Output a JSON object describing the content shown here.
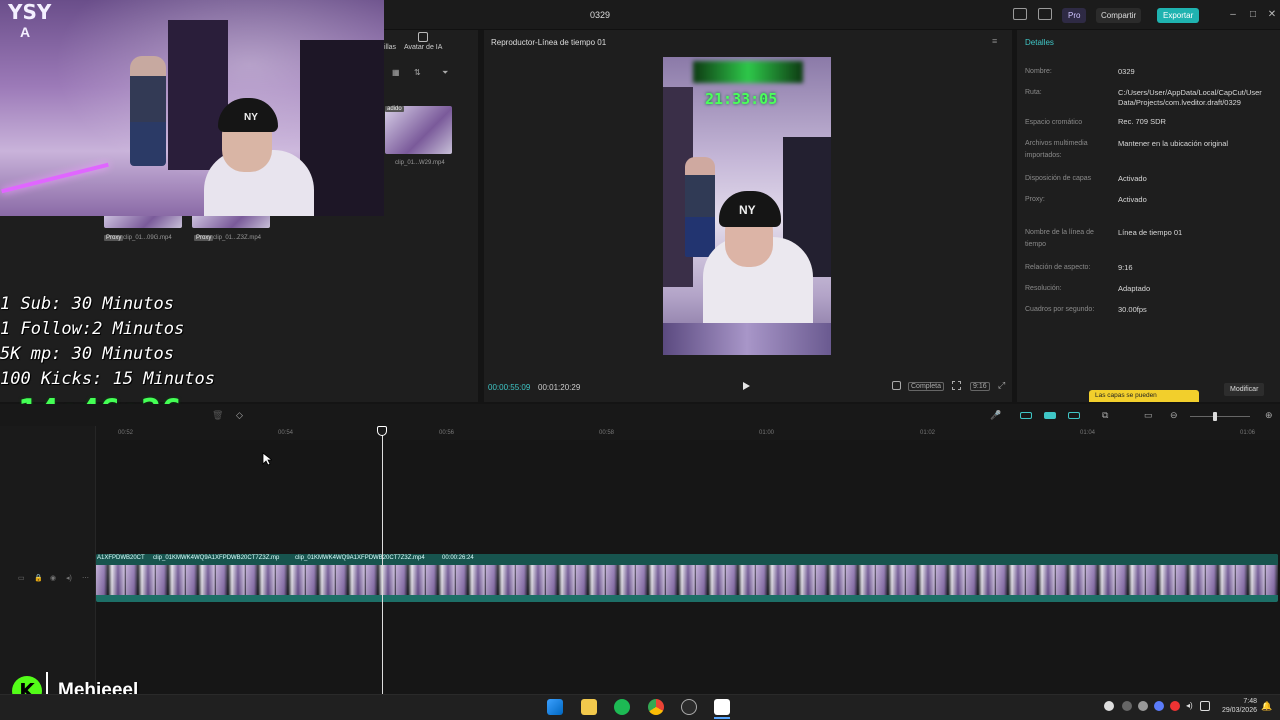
{
  "window": {
    "project_title": "0329",
    "pro_label": "Pro",
    "share_label": "Compartir",
    "export_label": "Exportar",
    "accent_color": "#1fb3b0"
  },
  "webcam": {
    "logo_line1": "YSY",
    "logo_line2": "A",
    "cap_logo": "NY"
  },
  "media_panel": {
    "tabs": [
      "illas",
      "Avatar de IA"
    ],
    "clip_tag": "adido",
    "clips": [
      {
        "proxy": "Proxy",
        "name": "clip_01...09G.mp4"
      },
      {
        "proxy": "Proxy",
        "name": "clip_01...Z3Z.mp4"
      },
      {
        "proxy": "",
        "name": "clip_01...W29.mp4"
      }
    ]
  },
  "overlay": {
    "lines": [
      "1 Sub: 30 Minutos",
      "1 Follow:2 Minutos",
      "5K mp: 30 Minutos",
      "100 Kicks: 15 Minutos"
    ],
    "timer": "14:46:26",
    "timer_color": "#44ff55"
  },
  "player": {
    "title": "Reproductor-Línea de tiempo 01",
    "preview_timer": "21:33:05",
    "current_time": "00:00:55:09",
    "total_time": "00:01:20:29",
    "full_label": "Completa",
    "ratio_label": "9:16"
  },
  "details": {
    "title": "Detalles",
    "rows": [
      {
        "label": "Nombre:",
        "value": "0329"
      },
      {
        "label": "Ruta:",
        "value": "C:/Users/User/AppData/Local/CapCut/User Data/Projects/com.lveditor.draft/0329"
      },
      {
        "label": "Espacio cromático",
        "value": "Rec. 709 SDR"
      },
      {
        "label": "Archivos multimedia importados:",
        "value": "Mantener en la ubicación original"
      },
      {
        "label": "Disposición de capas",
        "value": "Activado"
      },
      {
        "label": "Proxy:",
        "value": "Activado"
      },
      {
        "label": "Nombre de la línea de tiempo",
        "value": "Línea de tiempo 01"
      },
      {
        "label": "Relación de aspecto:",
        "value": "9:16"
      },
      {
        "label": "Resolución:",
        "value": "Adaptado"
      },
      {
        "label": "Cuadros por segundo:",
        "value": "30.00fps"
      }
    ],
    "tooltip": "Las capas se pueden",
    "modify_label": "Modificar"
  },
  "timeline": {
    "ticks": [
      "00:52",
      "00:54",
      "00:56",
      "00:58",
      "01:00",
      "01:02",
      "01:04",
      "01:06"
    ],
    "clip_labels": [
      "A1XFPDWB20CT",
      "clip_01KMWK4WQ9A1XFPDWB20CT7Z3Z.mp",
      "clip_01KMWK4WQ9A1XFPDWB20CT7Z3Z.mp4",
      "00:00:26:24"
    ]
  },
  "streamer": {
    "kick_letter": "K",
    "name": "Mehieeel",
    "brand_color": "#53fc18"
  },
  "taskbar": {
    "time": "7:48",
    "date": "29/03/2026"
  }
}
